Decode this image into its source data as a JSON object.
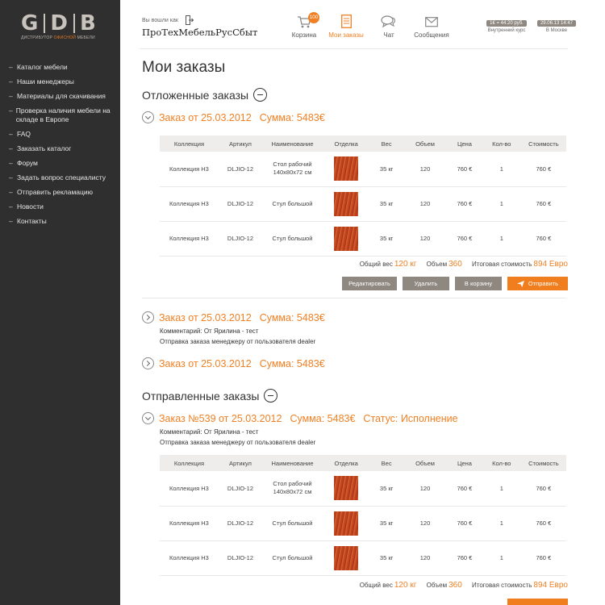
{
  "logo": {
    "letters": [
      "G",
      "D",
      "B"
    ],
    "sub_prefix": "ДИСТРИБУТОР ",
    "sub_accent": "ОФИСНОЙ",
    "sub_suffix": " МЕБЕЛИ"
  },
  "sidebar": {
    "items": [
      {
        "label": "Каталог мебели"
      },
      {
        "label": "Наши менеджеры"
      },
      {
        "label": "Материалы для скачивания"
      },
      {
        "label": "Проверка наличия мебели на складе в Европе"
      },
      {
        "label": "FAQ"
      },
      {
        "label": "Заказать каталог"
      },
      {
        "label": "Форум"
      },
      {
        "label": "Задать вопрос специалисту"
      },
      {
        "label": "Отправить рекламацию"
      },
      {
        "label": "Новости"
      },
      {
        "label": "Контакты"
      }
    ]
  },
  "header": {
    "logged_as": "Вы вошли как",
    "company": "ПроТехМебельРусСбыт",
    "nav": {
      "cart": {
        "label": "Корзина",
        "badge": "100"
      },
      "orders": {
        "label": "Мои заказы"
      },
      "chat": {
        "label": "Чат"
      },
      "messages": {
        "label": "Сообщения"
      }
    },
    "rate": {
      "value": "1€ = 44.20 руб.",
      "caption": "Внутренний курс"
    },
    "datetime": {
      "value": "29.06.13 14:47",
      "caption": "В Москве"
    }
  },
  "page": {
    "title": "Мои заказы",
    "deferred_title": "Отложенные заказы",
    "sent_title": "Отправленные заказы"
  },
  "table_headers": [
    "Коллекция",
    "Артикул",
    "Наименование",
    "Отделка",
    "Вес",
    "Объем",
    "Цена",
    "Кол-во",
    "Стоимость"
  ],
  "orders": {
    "d1": {
      "title": "Заказ от 25.03.2012",
      "sum": "Сумма: 5483€",
      "rows": [
        [
          "Коллекция Н3",
          "DLJIO-12",
          "Стол рабочий 140х80х72 см",
          "",
          "35 кг",
          "120",
          "760 €",
          "1",
          "760 €"
        ],
        [
          "Коллекция Н3",
          "DLJIO-12",
          "Стул большой",
          "",
          "35 кг",
          "120",
          "760 €",
          "1",
          "760 €"
        ],
        [
          "Коллекция Н3",
          "DLJIO-12",
          "Стул большой",
          "",
          "35 кг",
          "120",
          "760 €",
          "1",
          "760 €"
        ]
      ],
      "totals": {
        "weight_label": "Общий вес",
        "weight": "120 кг",
        "volume_label": "Объем",
        "volume": "360",
        "cost_label": "Итоговая стоимость",
        "cost": "894 Евро"
      },
      "buttons": {
        "edit": "Редактировать",
        "delete": "Удалить",
        "to_cart": "В корзину",
        "send": "Отправить"
      }
    },
    "d2": {
      "title": "Заказ от 25.03.2012",
      "sum": "Сумма: 5483€",
      "comment": "Комментарий: От Ярилина - тест",
      "note": "Отправка заказа менеджеру от пользователя dealer"
    },
    "d3": {
      "title": "Заказ от 25.03.2012",
      "sum": "Сумма: 5483€"
    },
    "s1": {
      "title": "Заказ №539 от 25.03.2012",
      "sum": "Сумма: 5483€",
      "status": "Статус: Исполнение",
      "comment": "Комментарий: От Ярилина - тест",
      "note": "Отправка заказа менеджеру от пользователя dealer",
      "rows": [
        [
          "Коллекция Н3",
          "DLJIO-12",
          "Стол рабочий 140х80х72 см",
          "",
          "35 кг",
          "120",
          "760 €",
          "1",
          "760 €"
        ],
        [
          "Коллекция Н3",
          "DLJIO-12",
          "Стул большой",
          "",
          "35 кг",
          "120",
          "760 €",
          "1",
          "760 €"
        ],
        [
          "Коллекция Н3",
          "DLJIO-12",
          "Стул большой",
          "",
          "35 кг",
          "120",
          "760 €",
          "1",
          "760 €"
        ]
      ],
      "totals": {
        "weight_label": "Общий вес",
        "weight": "120 кг",
        "volume_label": "Объем",
        "volume": "360",
        "cost_label": "Итоговая стоимость",
        "cost": "894 Евро"
      }
    }
  },
  "colors": {
    "accent": "#f08024",
    "sidebar": "#2f2f2f",
    "button_gray": "#8e8880"
  },
  "icons": {
    "cart": "cart-icon",
    "orders": "document-icon",
    "chat": "chat-bubbles-icon",
    "messages": "envelope-icon",
    "logout": "logout-icon"
  }
}
